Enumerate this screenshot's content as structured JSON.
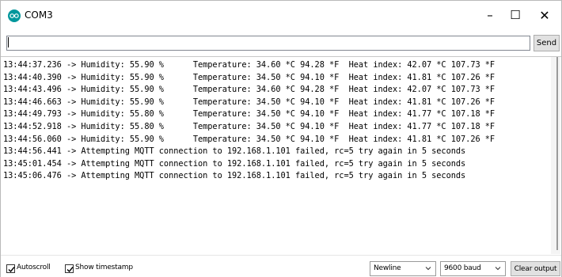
{
  "window": {
    "title": "COM3",
    "minimize_glyph": "–",
    "maximize_glyph": "☐",
    "close_glyph": "✕",
    "accent_color": "#00979c"
  },
  "command_bar": {
    "input_value": "",
    "send_label": "Send"
  },
  "output": {
    "lines": [
      "13:44:37.236 -> Humidity: 55.90 %      Temperature: 34.60 *C 94.28 *F  Heat index: 42.07 *C 107.73 *F",
      "13:44:40.390 -> Humidity: 55.90 %      Temperature: 34.50 *C 94.10 *F  Heat index: 41.81 *C 107.26 *F",
      "13:44:43.496 -> Humidity: 55.90 %      Temperature: 34.60 *C 94.28 *F  Heat index: 42.07 *C 107.73 *F",
      "13:44:46.663 -> Humidity: 55.90 %      Temperature: 34.50 *C 94.10 *F  Heat index: 41.81 *C 107.26 *F",
      "13:44:49.793 -> Humidity: 55.80 %      Temperature: 34.50 *C 94.10 *F  Heat index: 41.77 *C 107.18 *F",
      "13:44:52.918 -> Humidity: 55.80 %      Temperature: 34.50 *C 94.10 *F  Heat index: 41.77 *C 107.18 *F",
      "13:44:56.060 -> Humidity: 55.90 %      Temperature: 34.50 *C 94.10 *F  Heat index: 41.81 *C 107.26 *F",
      "13:44:56.441 -> Attempting MQTT connection to 192.168.1.101 failed, rc=5 try again in 5 seconds",
      "13:45:01.454 -> Attempting MQTT connection to 192.168.1.101 failed, rc=5 try again in 5 seconds",
      "13:45:06.476 -> Attempting MQTT connection to 192.168.1.101 failed, rc=5 try again in 5 seconds"
    ]
  },
  "status_bar": {
    "autoscroll_label": "Autoscroll",
    "autoscroll_checked": true,
    "timestamp_label": "Show timestamp",
    "timestamp_checked": true,
    "line_ending_selected": "Newline",
    "baud_selected": "9600 baud",
    "clear_label": "Clear output"
  }
}
